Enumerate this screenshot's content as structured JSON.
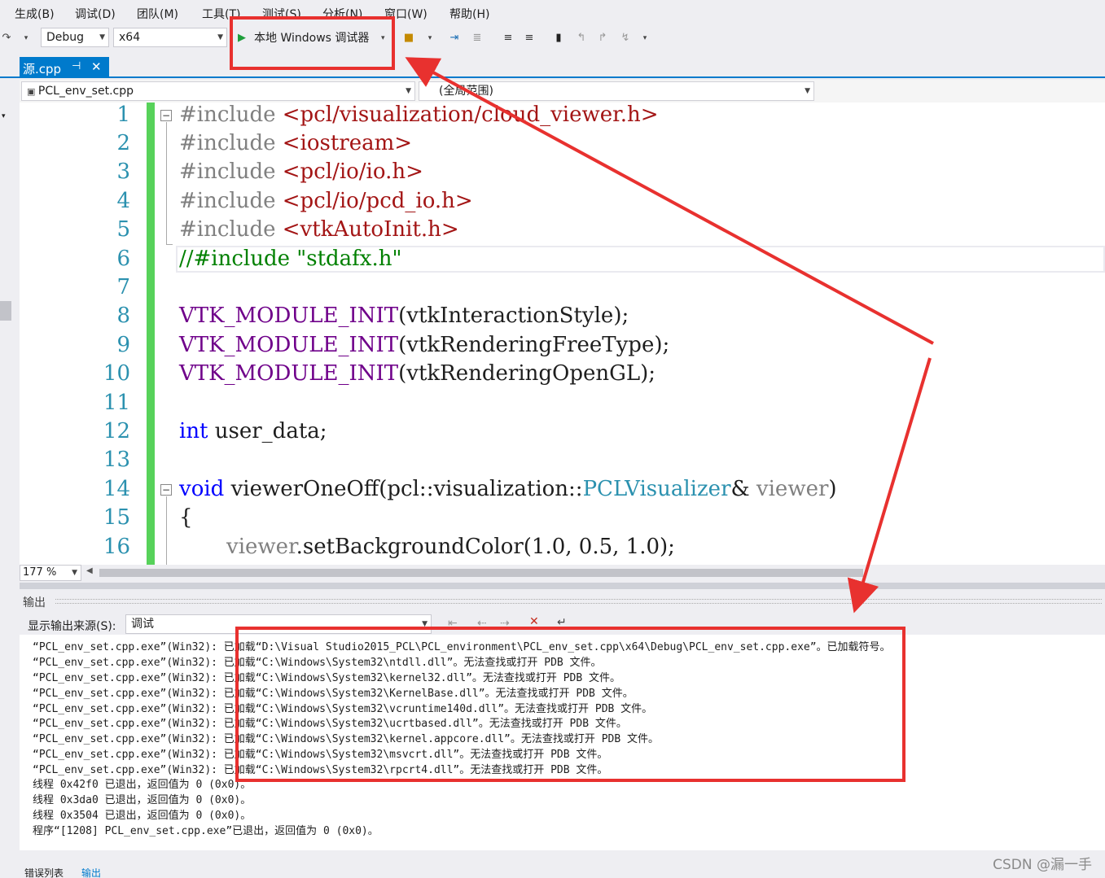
{
  "menu": [
    "生成(B)",
    "调试(D)",
    "团队(M)",
    "工具(T)",
    "测试(S)",
    "分析(N)",
    "窗口(W)",
    "帮助(H)"
  ],
  "toolbar": {
    "config": "Debug",
    "platform": "x64",
    "run_label": "本地 Windows 调试器"
  },
  "tab": {
    "name": "源.cpp",
    "pin": "⊣",
    "close": "✕"
  },
  "navbar": {
    "file": "PCL_env_set.cpp",
    "scope": "(全局范围)"
  },
  "editor": {
    "line_numbers": [
      "1",
      "2",
      "3",
      "4",
      "5",
      "6",
      "7",
      "8",
      "9",
      "10",
      "11",
      "12",
      "13",
      "14",
      "15",
      "16"
    ],
    "lines": {
      "l1_kw": "#include",
      "l1_str": " <pcl/visualization/cloud_viewer.h>",
      "l2_kw": "#include",
      "l2_str": " <iostream>",
      "l3_kw": "#include",
      "l3_str": " <pcl/io/io.h>",
      "l4_kw": "#include",
      "l4_str": " <pcl/io/pcd_io.h>",
      "l5_kw": "#include",
      "l5_str": " <vtkAutoInit.h>",
      "l6": "//#include \"stdafx.h\"",
      "l8_mac": "VTK_MODULE_INIT",
      "l8_rest": "(vtkInteractionStyle);",
      "l9_mac": "VTK_MODULE_INIT",
      "l9_rest": "(vtkRenderingFreeType);",
      "l10_mac": "VTK_MODULE_INIT",
      "l10_rest": "(vtkRenderingOpenGL);",
      "l12_kw": "int",
      "l12_rest": " user_data;",
      "l14_kw": "void",
      "l14_a": " viewerOneOff(pcl::visualization::",
      "l14_ty": "PCLVisualizer",
      "l14_b": "& ",
      "l14_par": "viewer",
      "l14_c": ")",
      "l15": "{",
      "l16_par": "viewer",
      "l16_rest": ".setBackgroundColor(1.0, 0.5, 1.0);"
    }
  },
  "zoom": "177 %",
  "output": {
    "title": "输出",
    "source_label": "显示输出来源(S):",
    "source_value": "调试",
    "lines": [
      "“PCL_env_set.cpp.exe”(Win32): 已加载“D:\\Visual Studio2015_PCL\\PCL_environment\\PCL_env_set.cpp\\x64\\Debug\\PCL_env_set.cpp.exe”。已加载符号。",
      "“PCL_env_set.cpp.exe”(Win32): 已加载“C:\\Windows\\System32\\ntdll.dll”。无法查找或打开 PDB 文件。",
      "“PCL_env_set.cpp.exe”(Win32): 已加载“C:\\Windows\\System32\\kernel32.dll”。无法查找或打开 PDB 文件。",
      "“PCL_env_set.cpp.exe”(Win32): 已加载“C:\\Windows\\System32\\KernelBase.dll”。无法查找或打开 PDB 文件。",
      "“PCL_env_set.cpp.exe”(Win32): 已加载“C:\\Windows\\System32\\vcruntime140d.dll”。无法查找或打开 PDB 文件。",
      "“PCL_env_set.cpp.exe”(Win32): 已加载“C:\\Windows\\System32\\ucrtbased.dll”。无法查找或打开 PDB 文件。",
      "“PCL_env_set.cpp.exe”(Win32): 已加载“C:\\Windows\\System32\\kernel.appcore.dll”。无法查找或打开 PDB 文件。",
      "“PCL_env_set.cpp.exe”(Win32): 已加载“C:\\Windows\\System32\\msvcrt.dll”。无法查找或打开 PDB 文件。",
      "“PCL_env_set.cpp.exe”(Win32): 已加载“C:\\Windows\\System32\\rpcrt4.dll”。无法查找或打开 PDB 文件。",
      "线程 0x42f0 已退出，返回值为 0 (0x0)。",
      "线程 0x3da0 已退出，返回值为 0 (0x0)。",
      "线程 0x3504 已退出，返回值为 0 (0x0)。",
      "程序“[1208] PCL_env_set.cpp.exe”已退出，返回值为 0 (0x0)。"
    ]
  },
  "bottom_tabs": [
    "错误列表",
    "输出"
  ],
  "watermark": "CSDN @漏一手",
  "colors": {
    "accent": "#007acc",
    "annotation": "#e8312f",
    "change_bar": "#57d25a"
  }
}
